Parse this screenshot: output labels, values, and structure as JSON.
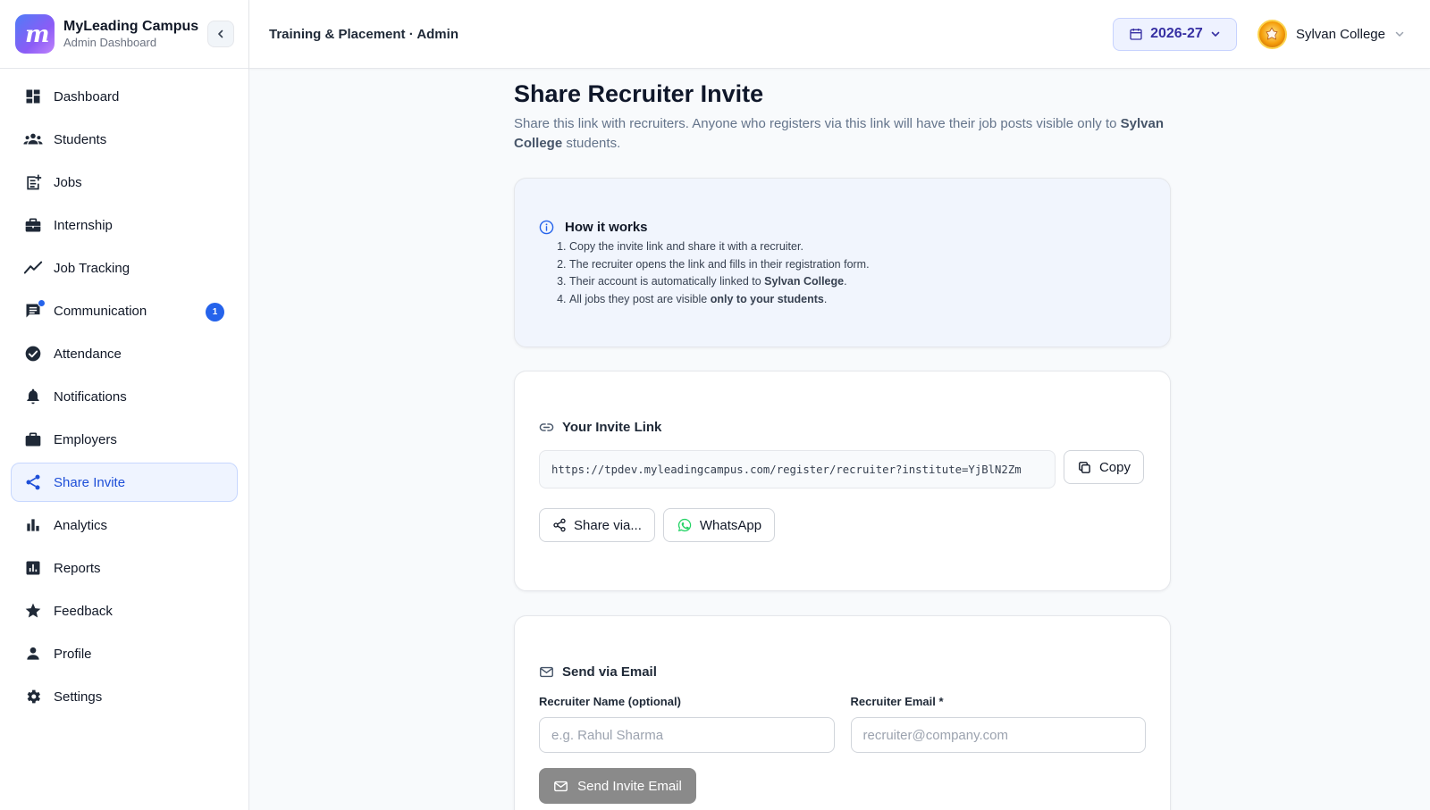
{
  "brand": {
    "name": "MyLeading Campus",
    "subtitle": "Admin Dashboard"
  },
  "sidebar": {
    "items": [
      {
        "label": "Dashboard",
        "icon": "dashboard-icon"
      },
      {
        "label": "Students",
        "icon": "students-icon"
      },
      {
        "label": "Jobs",
        "icon": "jobs-icon"
      },
      {
        "label": "Internship",
        "icon": "internship-icon"
      },
      {
        "label": "Job Tracking",
        "icon": "job-tracking-icon"
      },
      {
        "label": "Communication",
        "icon": "communication-icon",
        "badge": "1"
      },
      {
        "label": "Attendance",
        "icon": "attendance-icon"
      },
      {
        "label": "Notifications",
        "icon": "bell-icon"
      },
      {
        "label": "Employers",
        "icon": "employers-icon"
      },
      {
        "label": "Share Invite",
        "icon": "share-icon",
        "active": true
      },
      {
        "label": "Analytics",
        "icon": "analytics-icon"
      },
      {
        "label": "Reports",
        "icon": "reports-icon"
      },
      {
        "label": "Feedback",
        "icon": "star-icon"
      },
      {
        "label": "Profile",
        "icon": "person-icon"
      },
      {
        "label": "Settings",
        "icon": "gear-icon"
      }
    ]
  },
  "header": {
    "title": "Training & Placement · Admin",
    "academic_year": "2026-27",
    "college_name": "Sylvan College"
  },
  "page": {
    "title": "Share Recruiter Invite",
    "description_prefix": "Share this link with recruiters. Anyone who registers via this link will have their job posts visible only to",
    "description_college": "Sylvan College",
    "description_suffix": "students."
  },
  "how_it_works": {
    "title": "How it works",
    "step1": "Copy the invite link and share it with a recruiter.",
    "step2": "The recruiter opens the link and fills in their registration form.",
    "step3_prefix": "Their account is automatically linked to",
    "step3_college": "Sylvan College",
    "step4_prefix": "All jobs they post are visible",
    "step4_bold": "only to your students"
  },
  "invite_link": {
    "title": "Your Invite Link",
    "url": "https://tpdev.myleadingcampus.com/register/recruiter?institute=YjBlN2Zm",
    "copy_label": "Copy",
    "share_label": "Share via...",
    "whatsapp_label": "WhatsApp"
  },
  "email": {
    "title": "Send via Email",
    "name_label": "Recruiter Name (optional)",
    "name_placeholder": "e.g. Rahul Sharma",
    "email_label": "Recruiter Email *",
    "email_placeholder": "recruiter@company.com",
    "send_label": "Send Invite Email"
  },
  "colors": {
    "accent": "#2563eb",
    "active_bg": "#eff4ff",
    "year_bg": "#eef2ff",
    "whatsapp": "#25d366",
    "send_disabled": "#8a8a8a"
  }
}
